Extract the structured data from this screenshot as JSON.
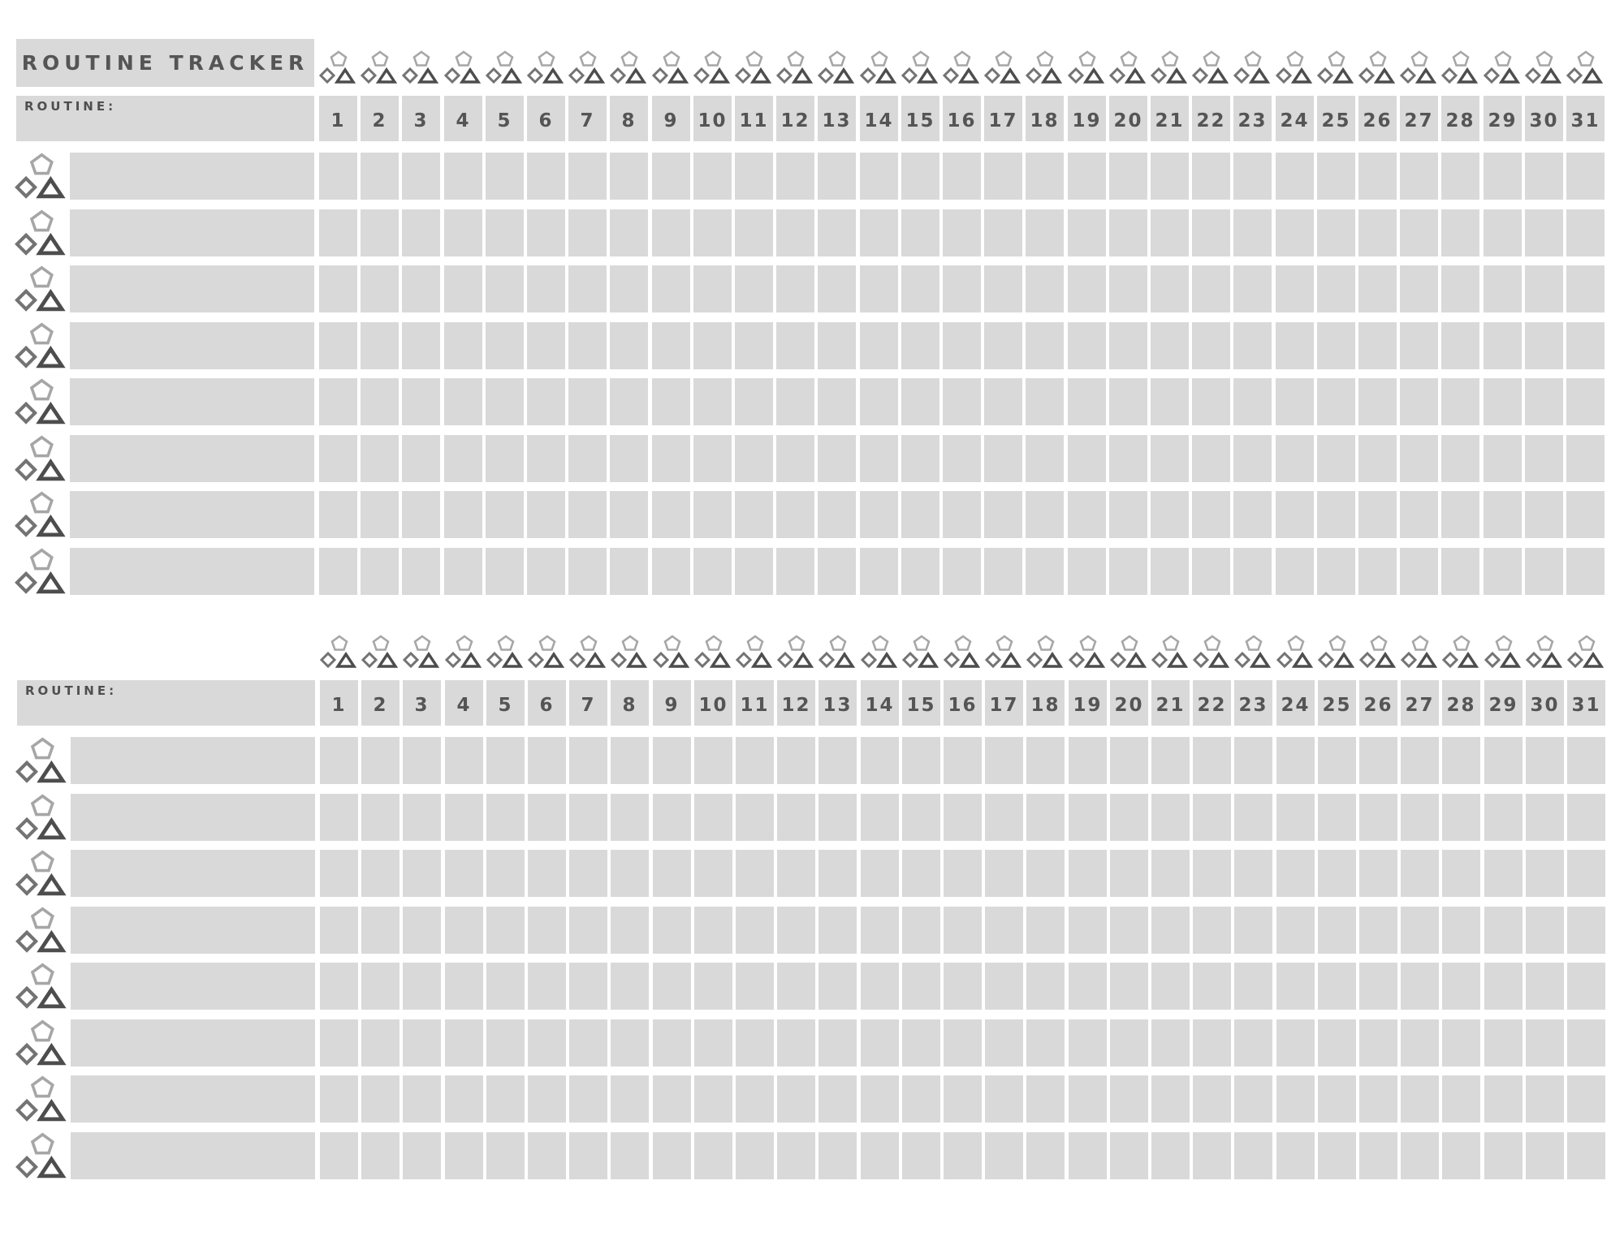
{
  "title": "ROUTINE TRACKER",
  "colors": {
    "cell": "#d9d9d9",
    "text": "#555555",
    "pentagon": "#a6a6a6",
    "diamond": "#737373",
    "triangle": "#4d4d4d"
  },
  "icons": {
    "header_icon": "pentagon-diamond-triangle-icon",
    "row_icon": "pentagon-diamond-triangle-icon"
  },
  "sections": [
    {
      "routine_label": "ROUTINE:",
      "routine_value": "",
      "days": [
        "1",
        "2",
        "3",
        "4",
        "5",
        "6",
        "7",
        "8",
        "9",
        "10",
        "11",
        "12",
        "13",
        "14",
        "15",
        "16",
        "17",
        "18",
        "19",
        "20",
        "21",
        "22",
        "23",
        "24",
        "25",
        "26",
        "27",
        "28",
        "29",
        "30",
        "31"
      ],
      "rows": [
        {
          "label": "",
          "checked": []
        },
        {
          "label": "",
          "checked": []
        },
        {
          "label": "",
          "checked": []
        },
        {
          "label": "",
          "checked": []
        },
        {
          "label": "",
          "checked": []
        },
        {
          "label": "",
          "checked": []
        },
        {
          "label": "",
          "checked": []
        },
        {
          "label": "",
          "checked": []
        }
      ]
    },
    {
      "routine_label": "ROUTINE:",
      "routine_value": "",
      "days": [
        "1",
        "2",
        "3",
        "4",
        "5",
        "6",
        "7",
        "8",
        "9",
        "10",
        "11",
        "12",
        "13",
        "14",
        "15",
        "16",
        "17",
        "18",
        "19",
        "20",
        "21",
        "22",
        "23",
        "24",
        "25",
        "26",
        "27",
        "28",
        "29",
        "30",
        "31"
      ],
      "rows": [
        {
          "label": "",
          "checked": []
        },
        {
          "label": "",
          "checked": []
        },
        {
          "label": "",
          "checked": []
        },
        {
          "label": "",
          "checked": []
        },
        {
          "label": "",
          "checked": []
        },
        {
          "label": "",
          "checked": []
        },
        {
          "label": "",
          "checked": []
        },
        {
          "label": "",
          "checked": []
        }
      ]
    }
  ]
}
